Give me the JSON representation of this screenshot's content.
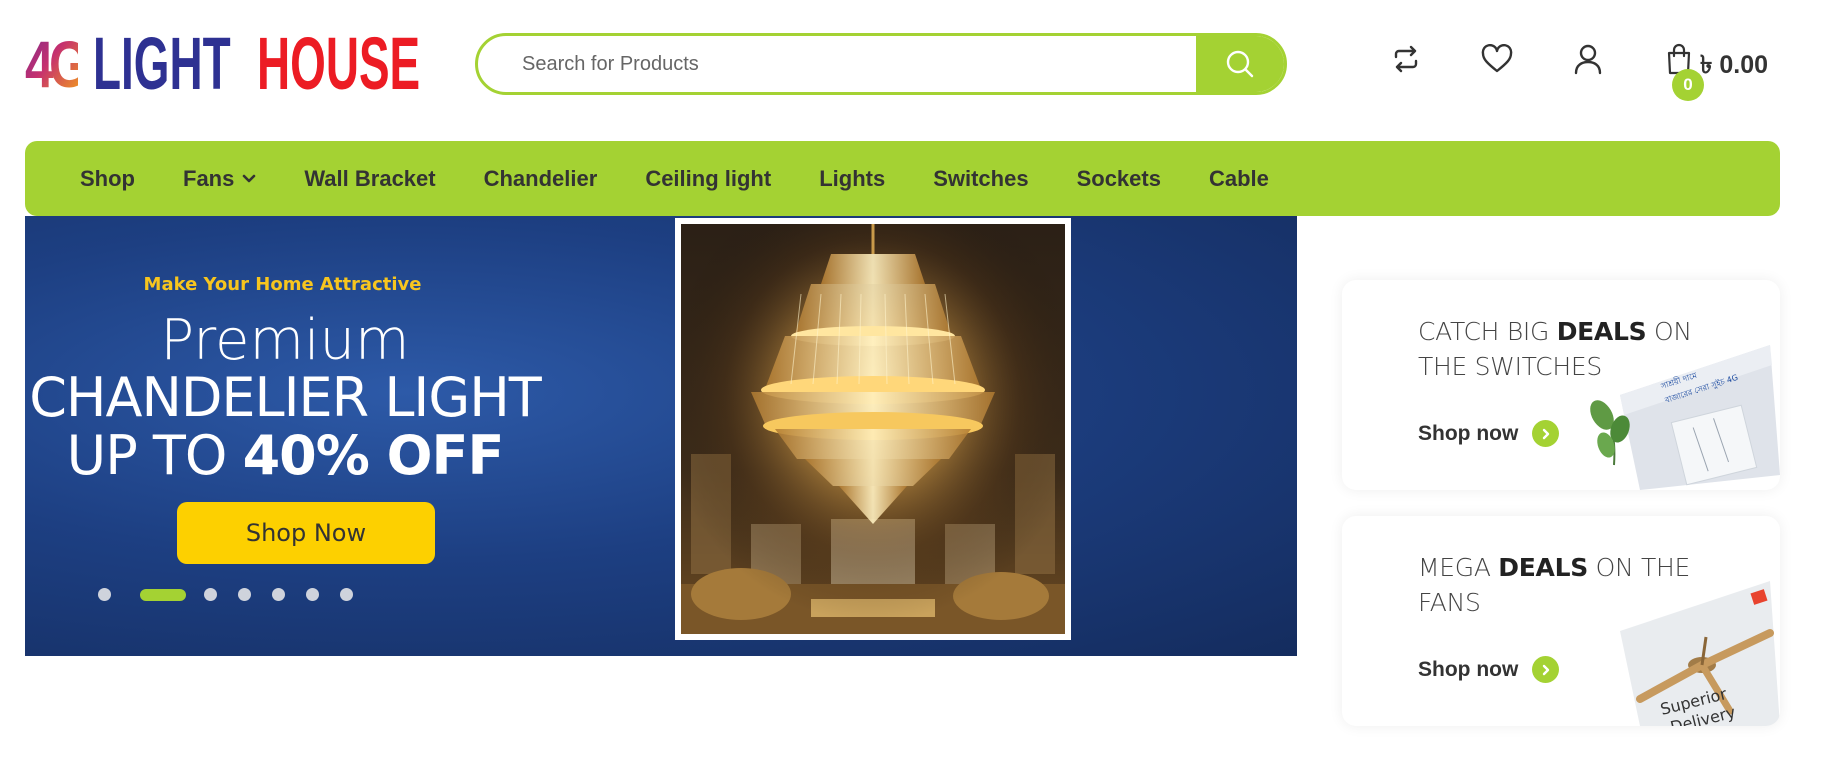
{
  "logo": {
    "part1": "4G",
    "part2": "LIGHT",
    "part3": "HOUSE"
  },
  "search": {
    "placeholder": "Search for Products"
  },
  "header": {
    "cart_count": "0",
    "cart_total": "৳ 0.00"
  },
  "nav": {
    "items": [
      "Shop",
      "Fans",
      "Wall Bracket",
      "Chandelier",
      "Ceiling light",
      "Lights",
      "Switches",
      "Sockets",
      "Cable"
    ]
  },
  "hero": {
    "tagline": "Make Your Home Attractive",
    "line1": "Premium",
    "line2": "CHANDELIER LIGHT",
    "line3_prefix": "UP TO ",
    "line3_bold": "40% OFF",
    "button": "Shop Now",
    "slide_count": 7,
    "active_slide": 2
  },
  "promos": [
    {
      "prefix": "CATCH BIG ",
      "bold": "DEALS",
      "suffix": " ON THE SWITCHES",
      "link": "Shop now",
      "image_caption_top": "সাশ্রয়ী দামে",
      "image_caption_mid": "বাজারের সেরা সুইচ 4G"
    },
    {
      "prefix": "MEGA ",
      "bold": "DEALS",
      "suffix": " ON THE FANS",
      "link": "Shop now",
      "image_caption": "Superior",
      "image_caption2": "Delivery"
    }
  ],
  "colors": {
    "accent": "#a4d233",
    "brand_blue": "#2e3192",
    "brand_red": "#ec1c24",
    "hero_bg": "#1d3f82",
    "button_yellow": "#fdd000"
  }
}
